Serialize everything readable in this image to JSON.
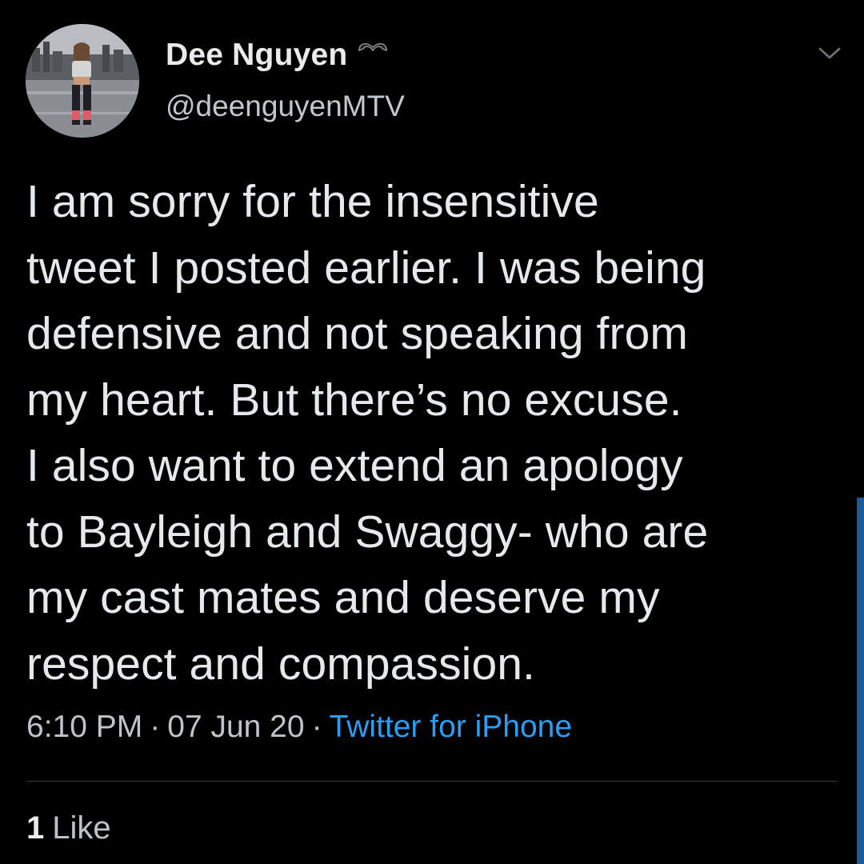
{
  "user": {
    "display_name": "Dee Nguyen",
    "handle": "@deenguyenMTV",
    "avatar_icon": "profile-photo",
    "badge_icon": "black-heart-icon"
  },
  "tweet": {
    "text": "I am sorry for the insensitive\ntweet I posted earlier. I was being\ndefensive and not speaking from\nmy heart. But there’s no excuse.\nI also want to extend an apology\nto Bayleigh and Swaggy- who are\nmy cast mates and deserve my\nrespect and compassion.",
    "time": "6:10 PM",
    "separator": "·",
    "date": "07 Jun 20",
    "source": "Twitter for iPhone"
  },
  "stats": {
    "likes_count": "1",
    "likes_label": "Like"
  },
  "colors": {
    "background": "#000000",
    "text": "#e6e9ec",
    "secondary_text": "#bfc4c9",
    "link": "#2a9df4",
    "divider": "#3a3d40"
  }
}
